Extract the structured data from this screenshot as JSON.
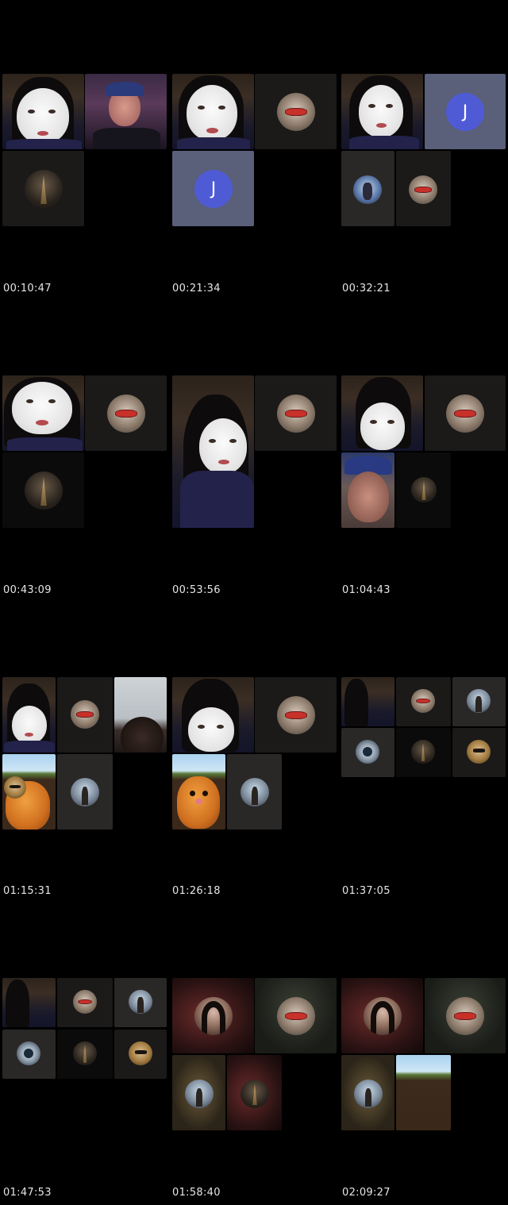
{
  "timestamps": [
    "00:10:47",
    "00:21:34",
    "00:32:21",
    "00:43:09",
    "00:53:56",
    "01:04:43",
    "01:15:31",
    "01:26:18",
    "01:37:05",
    "01:47:53",
    "01:58:40",
    "02:09:27"
  ],
  "avatars": {
    "letter_j": "J"
  },
  "colors": {
    "background": "#000000",
    "timestamp_text": "#e6e6e6",
    "avatar_letter_bg": "#4f5bd5",
    "tile_dark": "#1b1a19"
  }
}
